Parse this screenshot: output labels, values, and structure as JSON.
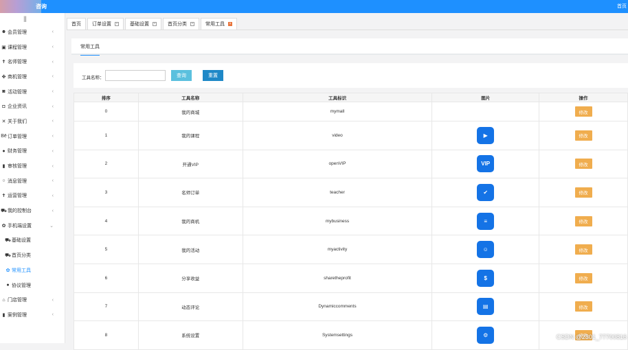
{
  "header": {
    "brand_suffix": "咨询",
    "right_link": "首页"
  },
  "sidebar": {
    "collapse_icon": "|||",
    "items": [
      {
        "label": "会员管理",
        "icon": "users-icon",
        "glyph": "☻",
        "arrow": "‹"
      },
      {
        "label": "课程管理",
        "icon": "book-icon",
        "glyph": "▣",
        "arrow": "‹"
      },
      {
        "label": "名师管理",
        "icon": "person-icon",
        "glyph": "✝",
        "arrow": "‹"
      },
      {
        "label": "商机管理",
        "icon": "handshake-icon",
        "glyph": "✤",
        "arrow": "‹"
      },
      {
        "label": "活动管理",
        "icon": "calendar-icon",
        "glyph": "◙",
        "arrow": "‹"
      },
      {
        "label": "企业资讯",
        "icon": "camera-icon",
        "glyph": "◘",
        "arrow": "‹"
      },
      {
        "label": "关于我们",
        "icon": "tools-icon",
        "glyph": "✕",
        "arrow": "‹"
      },
      {
        "label": "订单管理",
        "icon": "behance-icon",
        "glyph": "Bē",
        "arrow": "‹"
      },
      {
        "label": "财务管理",
        "icon": "bomb-icon",
        "glyph": "●",
        "arrow": "‹"
      },
      {
        "label": "审核管理",
        "icon": "document-icon",
        "glyph": "▮",
        "arrow": "‹"
      },
      {
        "label": "消息管理",
        "icon": "circle-icon",
        "glyph": "○",
        "arrow": "‹"
      },
      {
        "label": "运营管理",
        "icon": "person-icon",
        "glyph": "✝",
        "arrow": "‹"
      },
      {
        "label": "我的控制台",
        "icon": "car-icon",
        "glyph": "⛟",
        "arrow": "‹"
      },
      {
        "label": "手机端设置",
        "icon": "gear-icon",
        "glyph": "✿",
        "arrow": "⌄"
      },
      {
        "label": "基础设置",
        "icon": "car-icon",
        "glyph": "⛟",
        "sub": true
      },
      {
        "label": "首页分类",
        "icon": "car-icon",
        "glyph": "⛟",
        "sub": true
      },
      {
        "label": "常用工具",
        "icon": "gear-icon",
        "glyph": "✿",
        "sub": true,
        "active": true
      },
      {
        "label": "协议管理",
        "icon": "bomb-icon",
        "glyph": "●",
        "sub": true
      },
      {
        "label": "门店管理",
        "icon": "bank-icon",
        "glyph": "⌂",
        "arrow": "‹"
      },
      {
        "label": "案例管理",
        "icon": "document-icon",
        "glyph": "▮",
        "arrow": "‹"
      }
    ]
  },
  "tabs": [
    {
      "label": "首页",
      "closable": false
    },
    {
      "label": "订单设置",
      "closable": true
    },
    {
      "label": "基础设置",
      "closable": true
    },
    {
      "label": "首页分类",
      "closable": true
    },
    {
      "label": "常用工具",
      "closable": true,
      "active": true
    }
  ],
  "page": {
    "inner_tab": "常用工具",
    "search_label": "工具名称：",
    "search_value": "",
    "query_button": "查询",
    "reset_button": "重置"
  },
  "table": {
    "headers": [
      "排序",
      "工具名称",
      "工具标识",
      "图片",
      "操作"
    ],
    "rows": [
      {
        "order": "0",
        "name": "我的商城",
        "key": "mymall",
        "icon": "",
        "icon_glyph": "",
        "action": "修改"
      },
      {
        "order": "1",
        "name": "我的课程",
        "key": "video",
        "icon": "video-camera-icon",
        "icon_glyph": "▶",
        "action": "修改"
      },
      {
        "order": "2",
        "name": "开通VIP",
        "key": "openVIP",
        "icon": "vip-icon",
        "icon_glyph": "VIP",
        "action": "修改"
      },
      {
        "order": "3",
        "name": "名师订单",
        "key": "teacher",
        "icon": "clipboard-check-icon",
        "icon_glyph": "✔",
        "action": "修改"
      },
      {
        "order": "4",
        "name": "我的商机",
        "key": "mybusiness",
        "icon": "document-icon",
        "icon_glyph": "≡",
        "action": "修改"
      },
      {
        "order": "5",
        "name": "我的活动",
        "key": "myactivity",
        "icon": "people-icon",
        "icon_glyph": "☺",
        "action": "修改"
      },
      {
        "order": "6",
        "name": "分享收益",
        "key": "sharetheprofit",
        "icon": "money-hand-icon",
        "icon_glyph": "$",
        "action": "修改"
      },
      {
        "order": "7",
        "name": "动态评论",
        "key": "Dynamiccomments",
        "icon": "chat-icon",
        "icon_glyph": "▤",
        "action": "修改"
      },
      {
        "order": "8",
        "name": "系统设置",
        "key": "Systemsettings",
        "icon": "gear-icon",
        "icon_glyph": "⚙",
        "action": "修改"
      }
    ]
  },
  "watermark": "CSDN @2301_77700816"
}
